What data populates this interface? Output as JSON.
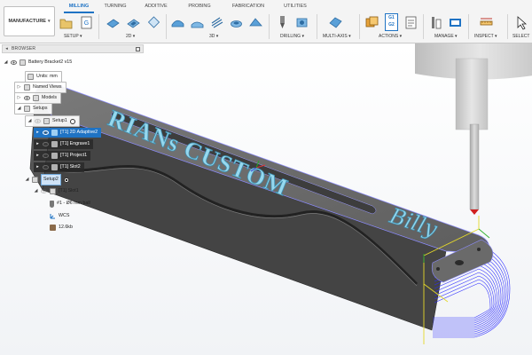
{
  "workspace": {
    "label": "MANUFACTURE"
  },
  "tabs": [
    {
      "label": "MILLING",
      "active": true
    },
    {
      "label": "TURNING",
      "active": false
    },
    {
      "label": "ADDITIVE",
      "active": false
    },
    {
      "label": "PROBING",
      "active": false
    },
    {
      "label": "FABRICATION",
      "active": false
    },
    {
      "label": "UTILITIES",
      "active": false
    }
  ],
  "groups": {
    "setup": "SETUP",
    "two_d": "2D",
    "three_d": "3D",
    "drilling": "DRILLING",
    "multi_axis": "MULTI-AXIS",
    "actions": "ACTIONS",
    "manage": "MANAGE",
    "inspect": "INSPECT",
    "select": "SELECT"
  },
  "actions_icon": {
    "line1": "G1",
    "line2": "G2"
  },
  "browser": {
    "title": "BROWSER",
    "document": "Battery Bracket2 v15",
    "units": "Units: mm",
    "named_views": "Named Views",
    "models": "Models",
    "setups": "Setups",
    "setup1": "Setup1",
    "op_adaptive": "[T1] 2D Adaptive2",
    "op_engrave": "[T1] Engrave1",
    "op_project": "[T1] Project1",
    "op_slot2": "[T1] Slot2",
    "setup2": "Setup2",
    "op_slot1": "[T1] Slot1",
    "tool": "#1 - Ø6 mm ball",
    "wcs": "WCS",
    "size": "12.6kb"
  },
  "engraving": {
    "text": "RIANs CUSTOM",
    "script": "Billy"
  },
  "colors": {
    "accent": "#1f73c4",
    "part_top": "#6c6c6c",
    "part_side": "#434343",
    "engrave": "#8fd6ee",
    "toolpath": "#2b2bff",
    "toolholder": "#cfcfcf"
  }
}
